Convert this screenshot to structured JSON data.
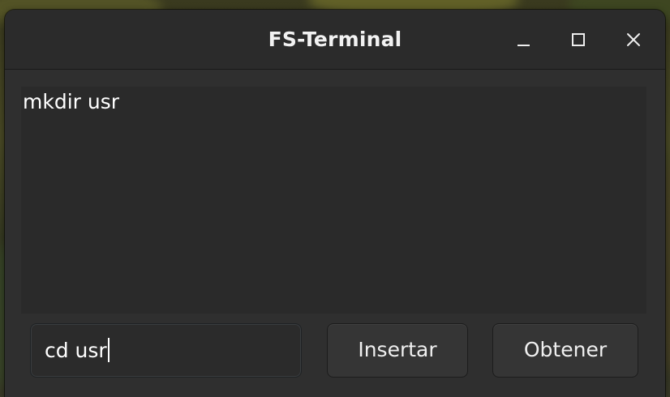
{
  "window": {
    "title": "FS-Terminal",
    "controls": {
      "minimize_icon": "minimize-icon",
      "maximize_icon": "maximize-icon",
      "close_icon": "close-icon"
    }
  },
  "output": {
    "text": "mkdir usr"
  },
  "command_input": {
    "value": "cd usr"
  },
  "buttons": {
    "insert_label": "Insertar",
    "get_label": "Obtener"
  },
  "colors": {
    "window_bg": "#2f2f2f",
    "titlebar_bg": "#2b2b2b",
    "text": "#ffffff"
  }
}
